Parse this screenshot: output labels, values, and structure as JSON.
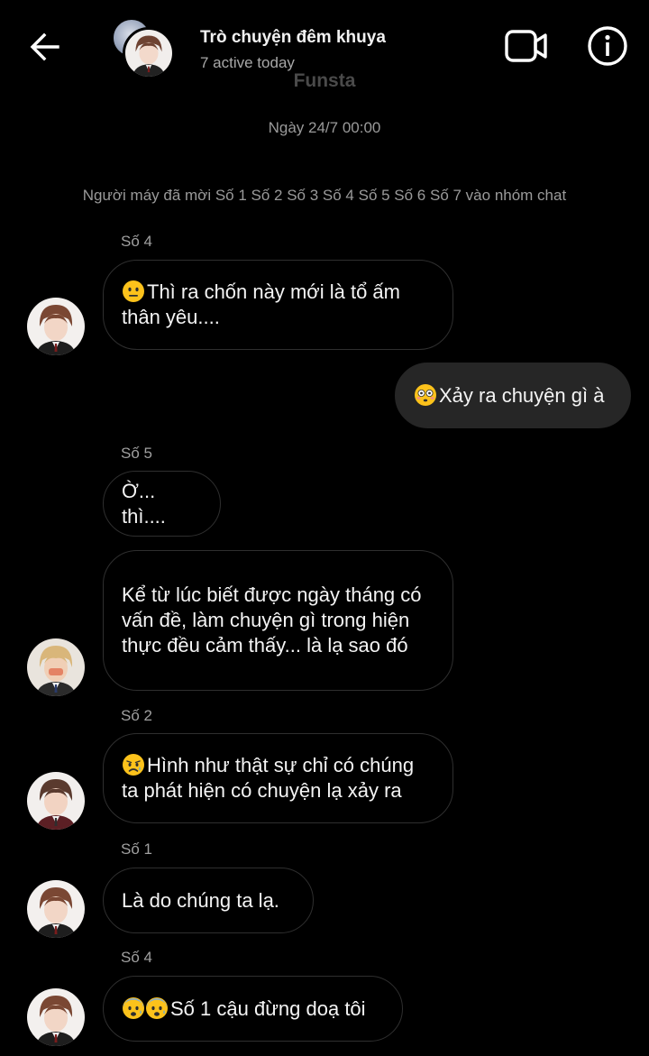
{
  "header": {
    "title": "Trò chuyện đêm khuya",
    "subtitle": "7 active today",
    "watermark": "Funsta",
    "back_icon": "arrow-left-icon",
    "video_icon": "video-call-icon",
    "info_icon": "info-icon"
  },
  "chat": {
    "timestamp": "Ngày 24/7 00:00",
    "system_message": "Người máy đã mời Số 1 Số 2 Số 3 Số 4 Số 5 Số 6 Số 7 vào nhóm chat",
    "messages": [
      {
        "sender": "Số 4",
        "text": "Thì ra chốn này mới là tổ ấm thân yêu....",
        "emoji": "neutral-face"
      },
      {
        "sender": "",
        "text": "Xảy ra chuyện gì à",
        "emoji": "flushed-face"
      },
      {
        "sender": "Số 5",
        "text": "Ờ... thì...."
      },
      {
        "sender": "",
        "text": "Kể từ lúc biết được ngày tháng có vấn đề, làm chuyện gì trong hiện thực đều cảm thấy... là lạ sao đó"
      },
      {
        "sender": "Số 2",
        "text": "Hình như thật sự chỉ có chúng ta phát hiện có chuyện lạ xảy ra",
        "emoji": "sad-face"
      },
      {
        "sender": "Số 1",
        "text": "Là do chúng ta lạ."
      },
      {
        "sender": "Số 4",
        "text": "Số 1 cậu đừng doạ tôi",
        "emoji": "fearful-face"
      }
    ]
  },
  "colors": {
    "background": "#000000",
    "outgoing_bubble": "#262626",
    "incoming_border": "#2f2f2f",
    "meta_text": "#9a9a9a"
  }
}
